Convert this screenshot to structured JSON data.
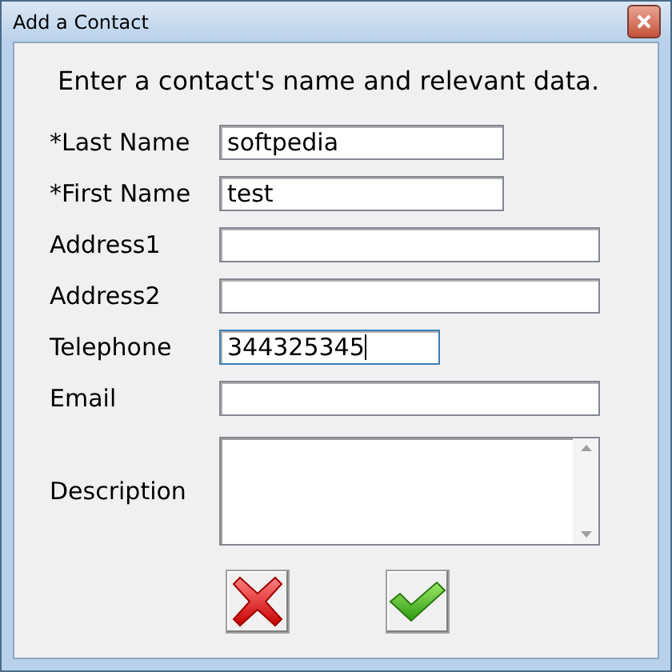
{
  "window": {
    "title": "Add a Contact"
  },
  "heading": "Enter a contact's name and relevant data.",
  "fields": [
    {
      "label": "*Last Name",
      "kind": "name",
      "value": "softpedia"
    },
    {
      "label": "*First Name",
      "kind": "name",
      "value": "test"
    },
    {
      "label": "Address1",
      "kind": "long"
    },
    {
      "label": "Address2",
      "kind": "long"
    },
    {
      "label": "Telephone",
      "kind": "phone",
      "value": "344325345",
      "focused": true
    },
    {
      "label": "Email",
      "kind": "long"
    },
    {
      "label": "Description",
      "kind": "memo"
    }
  ],
  "buttons": [
    {
      "kind": "cancel"
    },
    {
      "kind": "ok"
    }
  ]
}
